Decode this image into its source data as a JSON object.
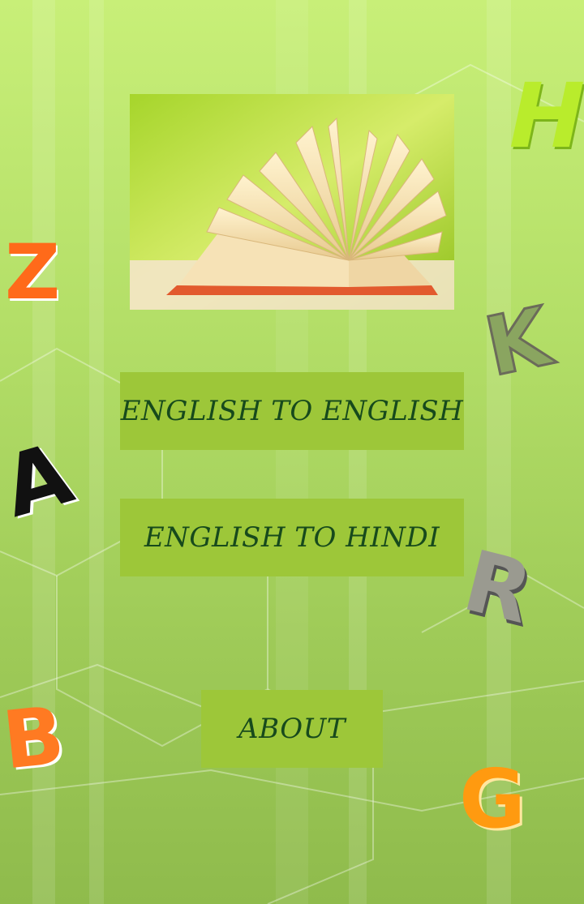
{
  "app": {
    "buttons": {
      "english_to_english": "ENGLISH TO ENGLISH",
      "english_to_hindi": "ENGLISH TO HINDI",
      "about": "ABOUT"
    },
    "decor_letters": [
      "H",
      "Z",
      "K",
      "A",
      "R",
      "B",
      "G"
    ],
    "colors": {
      "button_bg": "#9dc739",
      "button_text": "#174a1c",
      "background_top": "#c8ef78",
      "background_bottom": "#8fbb4c"
    },
    "hero_image": "open-book-icon"
  }
}
